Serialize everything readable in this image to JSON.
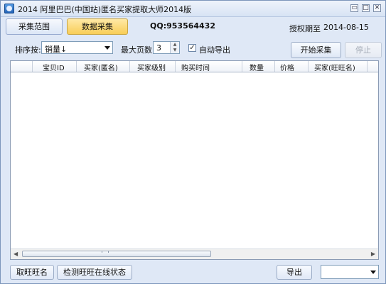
{
  "window": {
    "title": "2014 阿里巴巴(中国站)匿名买家提取大师2014版",
    "buttons": {
      "minimize": "▭",
      "maximize": "□",
      "close": "✕"
    }
  },
  "tabs": [
    {
      "label": "采集范围",
      "active": false
    },
    {
      "label": "数据采集",
      "active": true
    }
  ],
  "header": {
    "qq": "QQ:953564432",
    "license_label": "授权期至",
    "license_date": "2014-08-15"
  },
  "controls": {
    "sort_label": "排序按:",
    "sort_value": "销量↓",
    "max_pages_label": "最大页数:",
    "max_pages_value": "3",
    "auto_export_checked": true,
    "auto_export_label": "自动导出",
    "start_button": "开始采集",
    "stop_button": "停止"
  },
  "table": {
    "columns": [
      "宝贝ID",
      "买家(匿名)",
      "买家级别",
      "购买时间",
      "数量",
      "价格",
      "买家(旺旺名)"
    ],
    "rows": []
  },
  "footer": {
    "fetch_button": "取旺旺名",
    "check_button": "检测旺旺在线状态",
    "export_button": "导出",
    "export_format_value": ""
  },
  "colors": {
    "window_bg": "#dfe8f6",
    "active_tab": "#f8cd57",
    "border": "#7d96bb"
  }
}
